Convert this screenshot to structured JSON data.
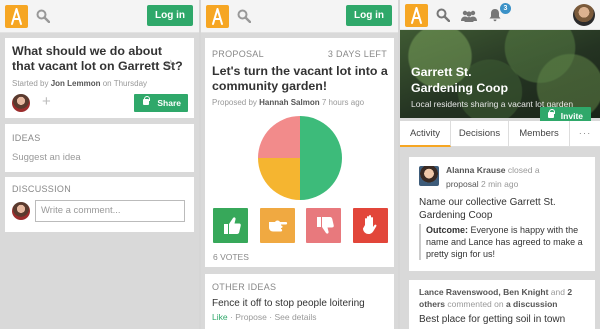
{
  "colors": {
    "accent": "#f6a623",
    "primary": "#2fa86a",
    "badge": "#3a91c7",
    "pie_agree": "#3dbb7a",
    "pie_abstain": "#f5b530",
    "pie_disagree": "#f28b8b",
    "vote_agree": "#37a85a",
    "vote_abstain": "#f0a941",
    "vote_disagree": "#e8797d",
    "vote_block": "#e2463a"
  },
  "icons": [
    "loomio-logo-icon",
    "search-icon",
    "star-icon",
    "plus-icon",
    "lock-icon",
    "group-icon",
    "bell-icon",
    "thumbs-up-icon",
    "hand-point-icon",
    "thumbs-down-icon",
    "stop-hand-icon"
  ],
  "screen1": {
    "login": "Log in",
    "question": "What should we do about that vacant lot on Garrett St?",
    "star": "☆",
    "started_prefix": "Started by",
    "started_by": "Jon Lemmon",
    "started_suffix": "on Thursday",
    "plus": "+",
    "share": "Share",
    "ideas_title": "IDEAS",
    "ideas_placeholder": "Suggest an idea",
    "discussion_title": "DISCUSSION",
    "comment_placeholder": "Write a comment..."
  },
  "screen2": {
    "login": "Log in",
    "label": "PROPOSAL",
    "days_left": "3 DAYS LEFT",
    "title": "Let's turn the vacant lot into a community garden!",
    "proposed_prefix": "Proposed by",
    "proposed_by": "Hannah Salmon",
    "proposed_when": "7 hours ago",
    "pie": {
      "agree": 3,
      "abstain": 1.5,
      "disagree": 1.5
    },
    "votes": "6 VOTES",
    "other_ideas_title": "OTHER IDEAS",
    "other_idea": "Fence it off to stop people loitering",
    "action_like": "Like",
    "action_propose": "Propose",
    "action_details": "See details",
    "separator": "·"
  },
  "screen3": {
    "notification_count": "3",
    "group_name": "Garrett St. Gardening Coop",
    "group_description": "Local residents sharing a vacant lot garden",
    "invite": "Invite",
    "tabs": [
      "Activity",
      "Decisions",
      "Members",
      "···"
    ],
    "activity1": {
      "actor": "Alanna Krause",
      "verb": "closed a",
      "object": "proposal",
      "time": "2 min ago",
      "name": "Name our collective Garrett St. Gardening Coop",
      "outcome_label": "Outcome:",
      "outcome": "Everyone is happy with the name and Lance has agreed to make a pretty sign for us!"
    },
    "activity2": {
      "actors": "Lance Ravenswood, Ben Knight",
      "and": "and",
      "others": "2 others",
      "verb": "commented on",
      "object": "a discussion",
      "title": "Best place for getting soil in town"
    }
  }
}
